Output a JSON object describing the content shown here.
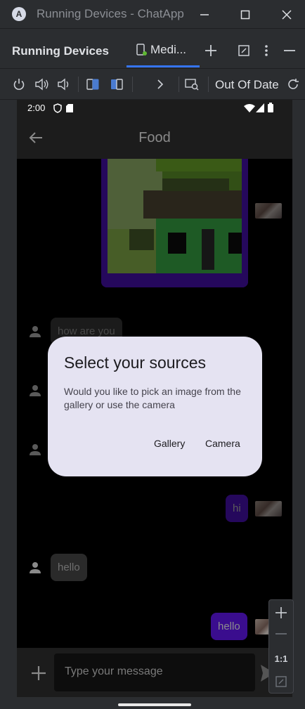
{
  "window": {
    "title": "Running Devices - ChatApp",
    "app_icon_letter": "A"
  },
  "tool_window": {
    "title": "Running Devices",
    "tab_label": "Medi..."
  },
  "device_toolbar": {
    "status": "Out Of Date"
  },
  "statusbar": {
    "time": "2:00"
  },
  "app": {
    "title": "Food",
    "messages": [
      {
        "type": "incoming",
        "text": "how are you"
      },
      {
        "type": "outgoing",
        "text": "hi"
      },
      {
        "type": "incoming",
        "text": "hello"
      },
      {
        "type": "outgoing",
        "text": "hello"
      }
    ],
    "input_placeholder": "Type your message"
  },
  "dialog": {
    "title": "Select your sources",
    "text": "Would you like to pick an image from the gallery or use the camera",
    "gallery_label": "Gallery",
    "camera_label": "Camera"
  },
  "zoom": {
    "actual_size_label": "1:1"
  },
  "colors": {
    "accent": "#3574f0",
    "bubble_outgoing": "#3a0d8e",
    "dialog_bg": "#e5e3f2"
  }
}
